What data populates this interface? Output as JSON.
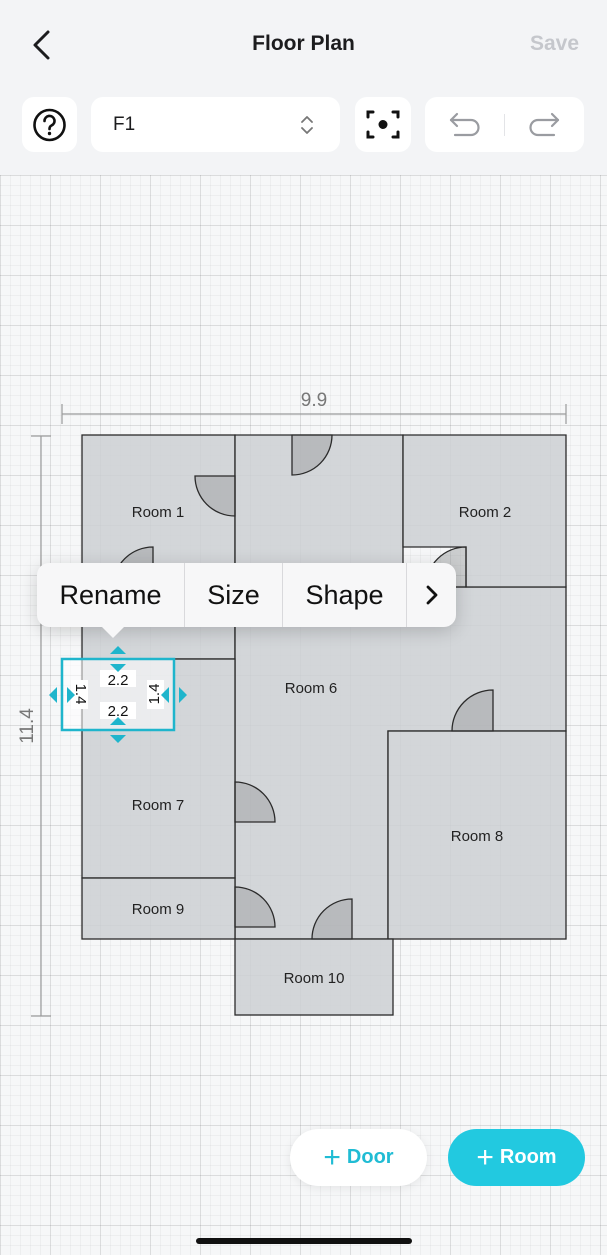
{
  "header": {
    "title": "Floor Plan",
    "back_icon": "chevron-left-icon",
    "save_label": "Save"
  },
  "toolbar": {
    "help_icon": "question-circle-icon",
    "floor_value": "F1",
    "floor_select_icon": "chevron-updown-icon",
    "center_icon": "focus-frame-icon",
    "undo_icon": "undo-icon",
    "redo_icon": "redo-icon"
  },
  "plan": {
    "width_label": "9.9",
    "height_label": "11.4",
    "rooms": [
      {
        "key": "room1",
        "name": "Room 1"
      },
      {
        "key": "room2",
        "name": "Room 2"
      },
      {
        "key": "room6",
        "name": "Room 6"
      },
      {
        "key": "room7",
        "name": "Room 7"
      },
      {
        "key": "room8",
        "name": "Room 8"
      },
      {
        "key": "room9",
        "name": "Room 9"
      },
      {
        "key": "room10",
        "name": "Room 10"
      }
    ],
    "selected_room": {
      "width_label": "2.2",
      "height_label": "1.4"
    }
  },
  "context_menu": {
    "items": [
      "Rename",
      "Size",
      "Shape"
    ],
    "more_icon": "chevron-right-icon"
  },
  "actions": {
    "door_label": "Door",
    "room_label": "Room",
    "plus_icon": "plus-icon"
  },
  "colors": {
    "accent": "#22c9e0",
    "room_fill": "#d9dbdd",
    "wall": "#2b2b2b",
    "selection": "#1fb5cc"
  }
}
